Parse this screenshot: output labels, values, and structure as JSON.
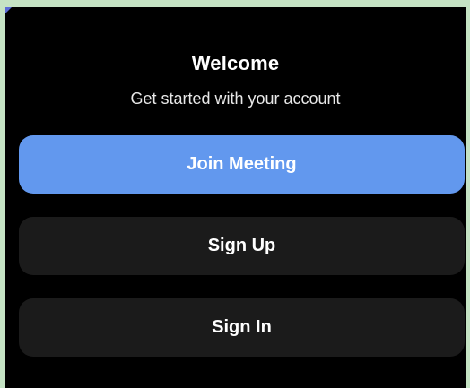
{
  "welcome": {
    "title": "Welcome",
    "subtitle": "Get started with your account"
  },
  "actions": {
    "join_meeting": "Join Meeting",
    "sign_up": "Sign Up",
    "sign_in": "Sign In"
  },
  "colors": {
    "primary": "#6298ee",
    "secondary": "#1b1b1b",
    "background": "#000000"
  }
}
